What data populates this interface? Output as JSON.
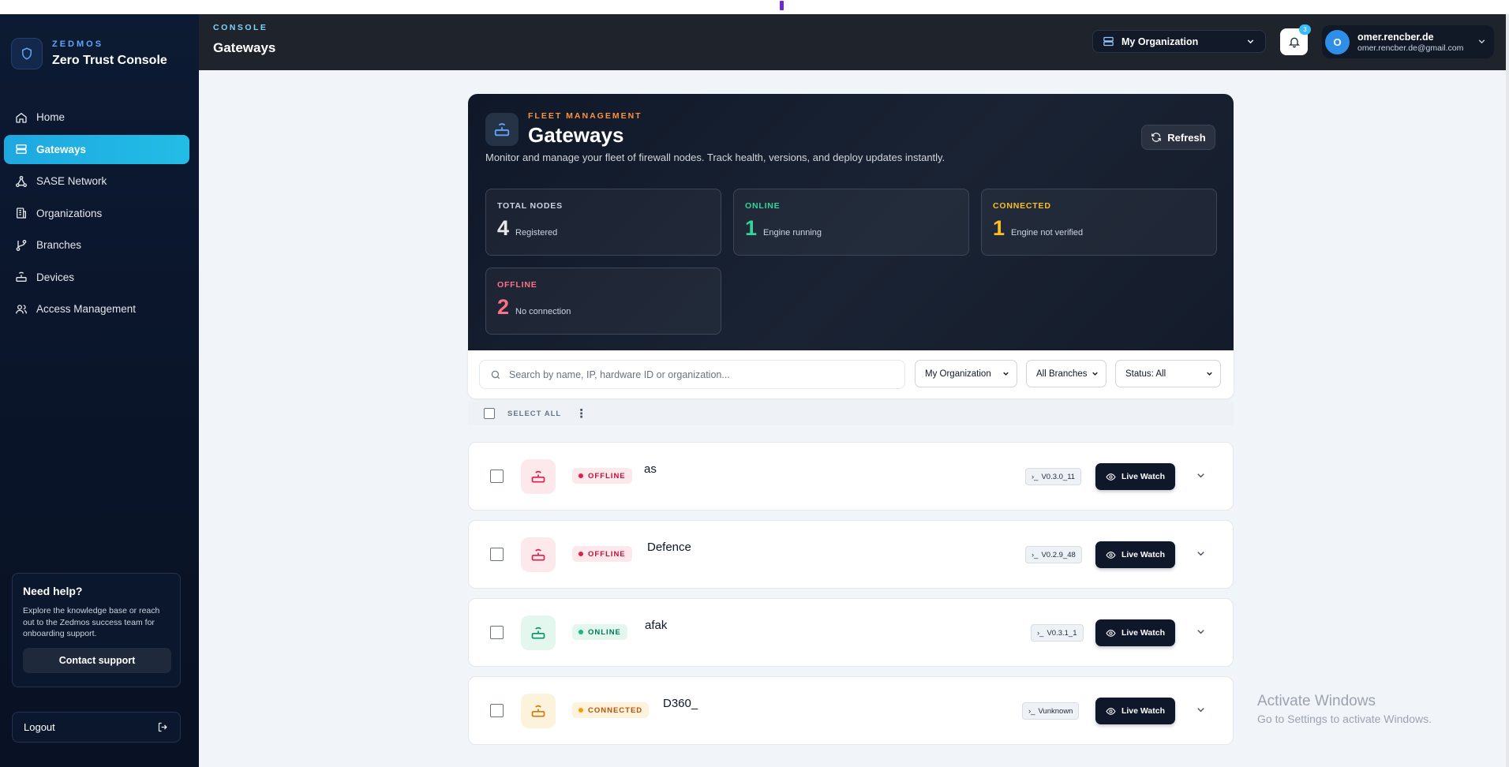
{
  "sidebar": {
    "brand_small": "ZEDMOS",
    "brand_title": "Zero Trust Console",
    "items": [
      {
        "label": "Home",
        "icon": "home-icon",
        "active": false
      },
      {
        "label": "Gateways",
        "icon": "server-icon",
        "active": true
      },
      {
        "label": "SASE Network",
        "icon": "network-icon",
        "active": false
      },
      {
        "label": "Organizations",
        "icon": "building-icon",
        "active": false
      },
      {
        "label": "Branches",
        "icon": "git-branch-icon",
        "active": false
      },
      {
        "label": "Devices",
        "icon": "router-icon",
        "active": false
      },
      {
        "label": "Access Management",
        "icon": "users-icon",
        "active": false
      }
    ],
    "help": {
      "title": "Need help?",
      "text": "Explore the knowledge base or reach out to the Zedmos success team for onboarding support.",
      "button": "Contact support"
    },
    "logout": "Logout"
  },
  "header": {
    "small": "CONSOLE",
    "title": "Gateways",
    "org": "My Organization",
    "notifications": "3",
    "user": {
      "initial": "O",
      "name": "omer.rencber.de",
      "email": "omer.rencber.de@gmail.com"
    }
  },
  "hero": {
    "kicker": "FLEET MANAGEMENT",
    "title": "Gateways",
    "subtitle": "Monitor and manage your fleet of firewall nodes. Track health, versions, and deploy updates instantly.",
    "refresh": "Refresh",
    "stats": [
      {
        "label": "TOTAL NODES",
        "value": "4",
        "caption": "Registered",
        "color": "#e5e7eb"
      },
      {
        "label": "ONLINE",
        "value": "1",
        "caption": "Engine running",
        "color": "#34d399"
      },
      {
        "label": "CONNECTED",
        "value": "1",
        "caption": "Engine not verified",
        "color": "#fbbf24"
      },
      {
        "label": "OFFLINE",
        "value": "2",
        "caption": "No connection",
        "color": "#fb7185"
      }
    ]
  },
  "toolbar": {
    "search_placeholder": "Search by name, IP, hardware ID or organization...",
    "org_filter": "My Organization",
    "branch_filter": "All Branches",
    "status_filter": "Status: All"
  },
  "list": {
    "select_all": "SELECT ALL",
    "live_watch": "Live Watch",
    "rows": [
      {
        "status": "OFFLINE",
        "name": "as",
        "version": "V0.3.0_11"
      },
      {
        "status": "OFFLINE",
        "name": "Defence",
        "version": "V0.2.9_48"
      },
      {
        "status": "ONLINE",
        "name": "afak",
        "version": "V0.3.1_1"
      },
      {
        "status": "CONNECTED",
        "name": "D360_",
        "version": "Vunknown"
      }
    ]
  },
  "watermark": {
    "line1": "Activate Windows",
    "line2": "Go to Settings to activate Windows."
  },
  "colors": {
    "accent": "#1ea8e0",
    "offline": "#e11d48",
    "online": "#059669",
    "connected": "#d97706",
    "kicker": "#fb923c"
  }
}
